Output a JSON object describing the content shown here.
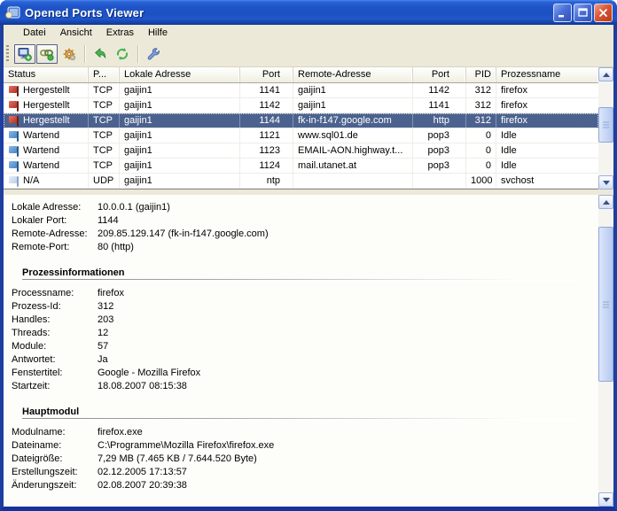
{
  "window": {
    "title": "Opened Ports Viewer"
  },
  "window_controls": {
    "minimize_icon": "minimize-icon",
    "maximize_icon": "maximize-icon",
    "close_icon": "close-icon"
  },
  "menu": {
    "items": [
      "Datei",
      "Ansicht",
      "Extras",
      "Hilfe"
    ]
  },
  "toolbar": {
    "buttons": [
      {
        "name": "remote-computers-button",
        "icon": "computer-add-icon",
        "toggled": true
      },
      {
        "name": "connections-button",
        "icon": "link-icon",
        "toggled": true
      },
      {
        "name": "services-button",
        "icon": "gear-icon",
        "toggled": false
      },
      {
        "name": "separator"
      },
      {
        "name": "back-button",
        "icon": "back-arrow-icon",
        "toggled": false
      },
      {
        "name": "refresh-button",
        "icon": "refresh-icon",
        "toggled": false
      },
      {
        "name": "separator"
      },
      {
        "name": "options-button",
        "icon": "wrench-icon",
        "toggled": false
      }
    ]
  },
  "table": {
    "columns": [
      "Status",
      "P...",
      "Lokale Adresse",
      "Port",
      "Remote-Adresse",
      "Port",
      "PID",
      "Prozessname"
    ],
    "rows": [
      {
        "flag": "red",
        "status": "Hergestellt",
        "protocol": "TCP",
        "local_address": "gaijin1",
        "local_port": "1141",
        "remote_address": "gaijin1",
        "remote_port": "1142",
        "pid": "312",
        "process": "firefox",
        "selected": false
      },
      {
        "flag": "red",
        "status": "Hergestellt",
        "protocol": "TCP",
        "local_address": "gaijin1",
        "local_port": "1142",
        "remote_address": "gaijin1",
        "remote_port": "1141",
        "pid": "312",
        "process": "firefox",
        "selected": false
      },
      {
        "flag": "red",
        "status": "Hergestellt",
        "protocol": "TCP",
        "local_address": "gaijin1",
        "local_port": "1144",
        "remote_address": "fk-in-f147.google.com",
        "remote_port": "http",
        "pid": "312",
        "process": "firefox",
        "selected": true
      },
      {
        "flag": "blue",
        "status": "Wartend",
        "protocol": "TCP",
        "local_address": "gaijin1",
        "local_port": "1121",
        "remote_address": "www.sql01.de",
        "remote_port": "pop3",
        "pid": "0",
        "process": "Idle",
        "selected": false
      },
      {
        "flag": "blue",
        "status": "Wartend",
        "protocol": "TCP",
        "local_address": "gaijin1",
        "local_port": "1123",
        "remote_address": "EMAIL-AON.highway.t...",
        "remote_port": "pop3",
        "pid": "0",
        "process": "Idle",
        "selected": false
      },
      {
        "flag": "blue",
        "status": "Wartend",
        "protocol": "TCP",
        "local_address": "gaijin1",
        "local_port": "1124",
        "remote_address": "mail.utanet.at",
        "remote_port": "pop3",
        "pid": "0",
        "process": "Idle",
        "selected": false
      },
      {
        "flag": "na",
        "status": "N/A",
        "protocol": "UDP",
        "local_address": "gaijin1",
        "local_port": "ntp",
        "remote_address": "",
        "remote_port": "",
        "pid": "1000",
        "process": "svchost",
        "selected": false
      }
    ]
  },
  "details": {
    "connection": [
      {
        "label": "Lokale Adresse:",
        "value": "10.0.0.1 (gaijin1)"
      },
      {
        "label": "Lokaler Port:",
        "value": "1144"
      },
      {
        "label": "Remote-Adresse:",
        "value": "209.85.129.147 (fk-in-f147.google.com)"
      },
      {
        "label": "Remote-Port:",
        "value": "80 (http)"
      }
    ],
    "process_section_title": "Prozessinformationen",
    "process": [
      {
        "label": "Processname:",
        "value": "firefox"
      },
      {
        "label": "Prozess-Id:",
        "value": "312"
      },
      {
        "label": "Handles:",
        "value": "203"
      },
      {
        "label": "Threads:",
        "value": "12"
      },
      {
        "label": "Module:",
        "value": "57"
      },
      {
        "label": "Antwortet:",
        "value": "Ja"
      },
      {
        "label": "Fenstertitel:",
        "value": "Google - Mozilla Firefox"
      },
      {
        "label": "Startzeit:",
        "value": "18.08.2007 08:15:38"
      }
    ],
    "module_section_title": "Hauptmodul",
    "module": [
      {
        "label": "Modulname:",
        "value": "firefox.exe"
      },
      {
        "label": "Dateiname:",
        "value": "C:\\Programme\\Mozilla Firefox\\firefox.exe"
      },
      {
        "label": "Dateigröße:",
        "value": "7,29 MB (7.465 KB / 7.644.520 Byte)"
      },
      {
        "label": "Erstellungszeit:",
        "value": "02.12.2005 17:13:57"
      },
      {
        "label": "Änderungszeit:",
        "value": "02.08.2007 20:39:38"
      }
    ]
  },
  "colors": {
    "titlebar_blue": "#1f55c8",
    "selection_blue": "#4c628e",
    "chrome_beige": "#ECE9D8",
    "flag_established": "#b03328",
    "flag_waiting": "#4a86c8",
    "flag_na": "#bcd0ea"
  }
}
